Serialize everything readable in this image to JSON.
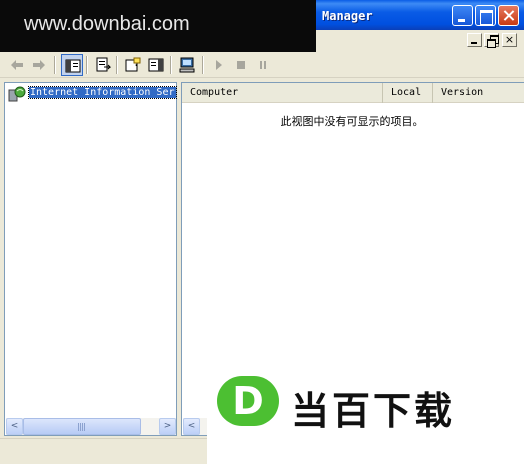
{
  "window": {
    "title": "Manager",
    "title_bar_color": "#0a5ce6"
  },
  "watermark_top": {
    "text": "www.downbai.com"
  },
  "watermark_bottom": {
    "logo_letter": "D",
    "text": "当百下载",
    "logo_color": "#4cbf32"
  },
  "mdi": {
    "close_glyph": "×"
  },
  "toolbar": {
    "items": [
      "back-arrow-icon",
      "forward-arrow-icon",
      "show-hide-console-tree-icon",
      "export-list-icon",
      "help-icon",
      "action-pane-icon",
      "connect-computer-icon",
      "play-icon",
      "stop-icon",
      "pause-icon"
    ]
  },
  "tree": {
    "root_label": "Internet Information Ser",
    "selection_color": "#316ac5"
  },
  "list": {
    "columns": [
      "Computer",
      "Local",
      "Version"
    ],
    "empty_message": "此视图中没有可显示的项目。"
  },
  "scrollbar": {
    "left_arrow": "<",
    "right_arrow": ">"
  }
}
